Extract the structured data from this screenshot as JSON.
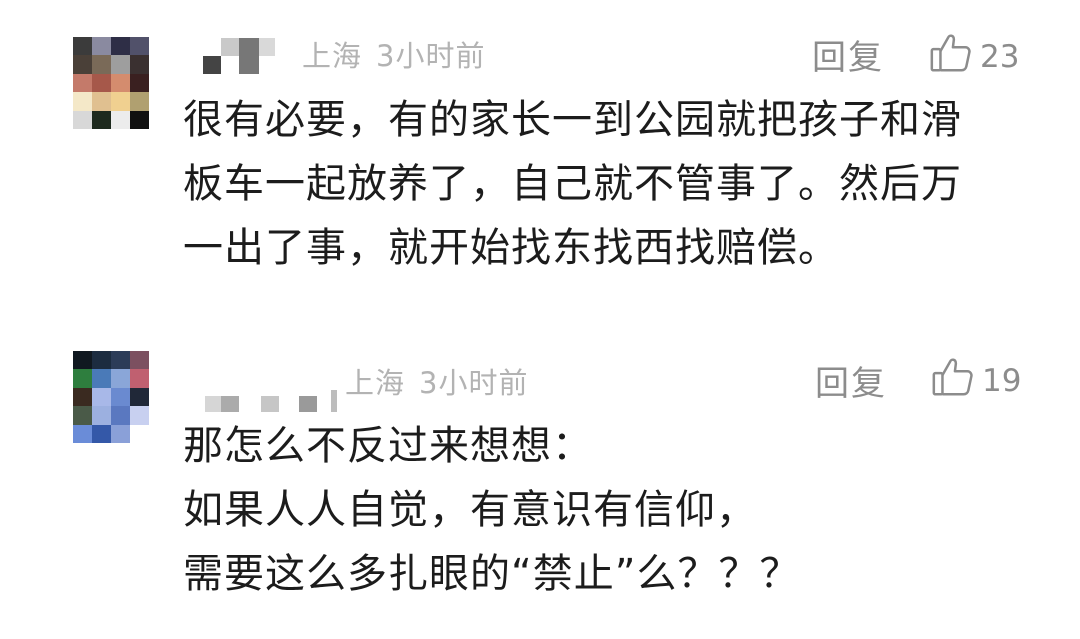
{
  "comments": [
    {
      "location": "上海",
      "time": "3小时前",
      "reply_label": "回复",
      "likes": "23",
      "lines": [
        "很有必要，有的家长一到公园就把孩子和滑",
        "板车一起放养了，自己就不管事了。然后万",
        "一出了事，就开始找东找西找赔偿。"
      ]
    },
    {
      "location": "上海",
      "time": "3小时前",
      "reply_label": "回复",
      "likes": "19",
      "lines": [
        "那怎么不反过来想想：",
        "如果人人自觉，有意识有信仰，",
        "需要这么多扎眼的“禁止”么？？？"
      ]
    }
  ],
  "icons": {
    "like": "thumbs-up-icon"
  },
  "colors": {
    "text": "#1c1c1c",
    "meta": "#b3b3b3",
    "action": "#8c8c8c"
  }
}
